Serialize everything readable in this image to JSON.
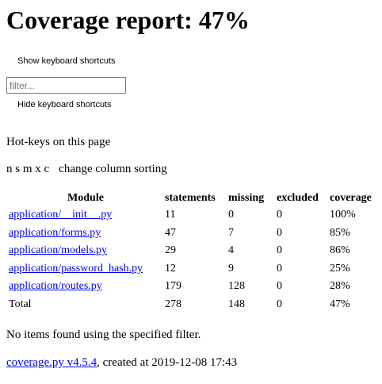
{
  "page": {
    "title": "Coverage report: 47%"
  },
  "controls": {
    "show_shortcuts_label": "Show keyboard shortcuts",
    "hide_shortcuts_label": "Hide keyboard shortcuts",
    "filter_placeholder": "filter..."
  },
  "hotkeys": {
    "heading": "Hot-keys on this page",
    "keys": "n s m x c",
    "description": "change column sorting"
  },
  "table": {
    "headers": {
      "module": "Module",
      "statements": "statements",
      "missing": "missing",
      "excluded": "excluded",
      "coverage": "coverage"
    },
    "rows": [
      {
        "module": "application/__init__.py",
        "statements": "11",
        "missing": "0",
        "excluded": "0",
        "coverage": "100%"
      },
      {
        "module": "application/forms.py",
        "statements": "47",
        "missing": "7",
        "excluded": "0",
        "coverage": "85%"
      },
      {
        "module": "application/models.py",
        "statements": "29",
        "missing": "4",
        "excluded": "0",
        "coverage": "86%"
      },
      {
        "module": "application/password_hash.py",
        "statements": "12",
        "missing": "9",
        "excluded": "0",
        "coverage": "25%"
      },
      {
        "module": "application/routes.py",
        "statements": "179",
        "missing": "128",
        "excluded": "0",
        "coverage": "28%"
      }
    ],
    "total": {
      "label": "Total",
      "statements": "278",
      "missing": "148",
      "excluded": "0",
      "coverage": "47%"
    }
  },
  "messages": {
    "no_items": "No items found using the specified filter."
  },
  "footer": {
    "link_text": "coverage.py v4.5.4",
    "created_text": ", created at 2019-12-08 17:43"
  }
}
